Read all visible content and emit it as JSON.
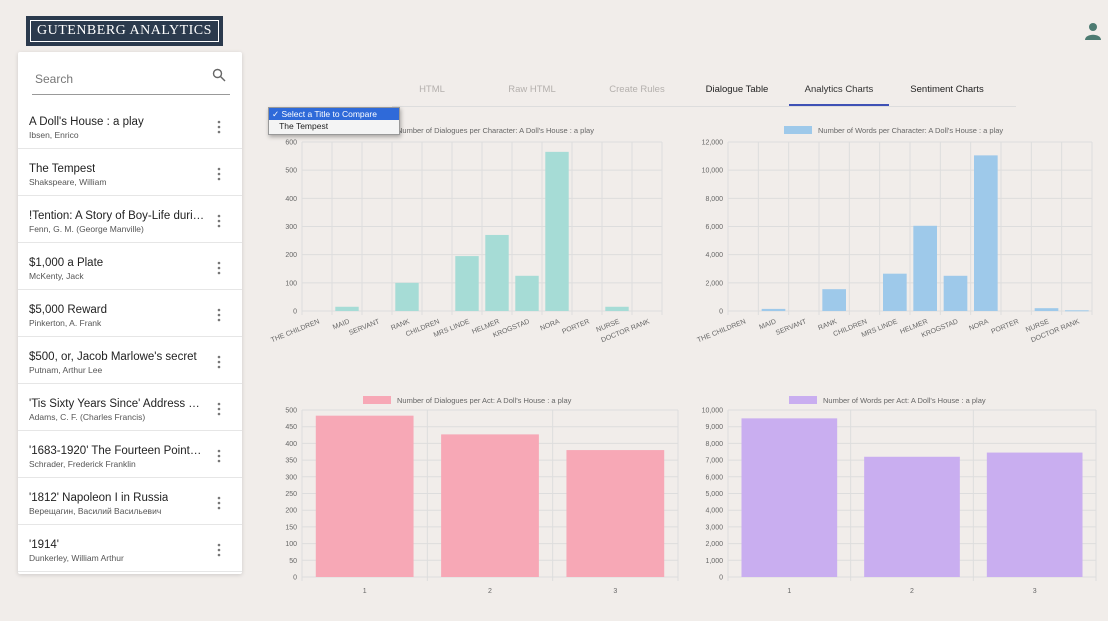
{
  "app": {
    "title": "GUTENBERG ANALYTICS"
  },
  "search": {
    "placeholder": "Search"
  },
  "books": [
    {
      "title": "A Doll's House : a play",
      "author": "Ibsen, Enrico"
    },
    {
      "title": "The Tempest",
      "author": "Shakspeare, William"
    },
    {
      "title": "!Tention: A Story of Boy-Life during th...",
      "author": "Fenn, G. M. (George Manville)"
    },
    {
      "title": "$1,000 a Plate",
      "author": "McKenty, Jack"
    },
    {
      "title": "$5,000 Reward",
      "author": "Pinkerton, A. Frank"
    },
    {
      "title": "$500, or, Jacob Marlowe's secret",
      "author": "Putnam, Arthur Lee"
    },
    {
      "title": "'Tis Sixty Years Since' Address of Ch...",
      "author": "Adams, C. F. (Charles Francis)"
    },
    {
      "title": "'1683-1920' The Fourteen Points and ...",
      "author": "Schrader, Frederick Franklin"
    },
    {
      "title": "'1812' Napoleon I in Russia",
      "author": "Верещагин, Василий Васильевич"
    },
    {
      "title": "'1914'",
      "author": "Dunkerley, William Arthur"
    }
  ],
  "tabs": [
    {
      "label": "HTML",
      "state": "disabled"
    },
    {
      "label": "Raw HTML",
      "state": "disabled"
    },
    {
      "label": "Create Rules",
      "state": "disabled"
    },
    {
      "label": "Dialogue Table",
      "state": "enabled"
    },
    {
      "label": "Analytics Charts",
      "state": "active"
    },
    {
      "label": "Sentiment Charts",
      "state": "enabled"
    }
  ],
  "compare_dropdown": {
    "options": [
      "Select a Title to Compare",
      "The Tempest"
    ],
    "selected": "Select a Title to Compare",
    "check_mark": "✓"
  },
  "colors": {
    "teal": "#a6dcd6",
    "blue": "#9ec9ea",
    "pink": "#f7a8b6",
    "purple": "#c9aef0",
    "accent": "#3f51b5"
  },
  "chart_data": [
    {
      "type": "bar",
      "title": "Number of Dialogues per Character: A Doll's House : a play",
      "color": "#a6dcd6",
      "categories": [
        "THE CHILDREN",
        "MAID",
        "SERVANT",
        "RANK",
        "CHILDREN",
        "MRS LINDE",
        "HELMER",
        "KROGSTAD",
        "NORA",
        "PORTER",
        "NURSE",
        "DOCTOR RANK"
      ],
      "values": [
        0,
        15,
        0,
        100,
        0,
        195,
        270,
        125,
        565,
        0,
        15,
        0
      ],
      "ylim": [
        0,
        600
      ],
      "yticks": [
        "0",
        "100",
        "200",
        "300",
        "400",
        "500",
        "600"
      ],
      "grid": true
    },
    {
      "type": "bar",
      "title": "Number of Words per Character: A Doll's House : a play",
      "color": "#9ec9ea",
      "categories": [
        "THE CHILDREN",
        "MAID",
        "SERVANT",
        "RANK",
        "CHILDREN",
        "MRS LINDE",
        "HELMER",
        "KROGSTAD",
        "NORA",
        "PORTER",
        "NURSE",
        "DOCTOR RANK"
      ],
      "values": [
        0,
        150,
        0,
        1550,
        0,
        2650,
        6050,
        2500,
        11050,
        0,
        200,
        50
      ],
      "ylim": [
        0,
        12000
      ],
      "yticks": [
        "0",
        "2,000",
        "4,000",
        "6,000",
        "8,000",
        "10,000",
        "12,000"
      ],
      "grid": true
    },
    {
      "type": "bar",
      "title": "Number of Dialogues per Act: A Doll's House : a play",
      "color": "#f7a8b6",
      "categories": [
        "1",
        "2",
        "3"
      ],
      "values": [
        483,
        427,
        380
      ],
      "ylim": [
        0,
        500
      ],
      "yticks": [
        "0",
        "50",
        "100",
        "150",
        "200",
        "250",
        "300",
        "350",
        "400",
        "450",
        "500"
      ],
      "grid": true
    },
    {
      "type": "bar",
      "title": "Number of Words per Act: A Doll's House : a play",
      "color": "#c9aef0",
      "categories": [
        "1",
        "2",
        "3"
      ],
      "values": [
        9500,
        7200,
        7450
      ],
      "ylim": [
        0,
        10000
      ],
      "yticks": [
        "0",
        "1,000",
        "2,000",
        "3,000",
        "4,000",
        "5,000",
        "6,000",
        "7,000",
        "8,000",
        "9,000",
        "10,000"
      ],
      "grid": true
    }
  ]
}
